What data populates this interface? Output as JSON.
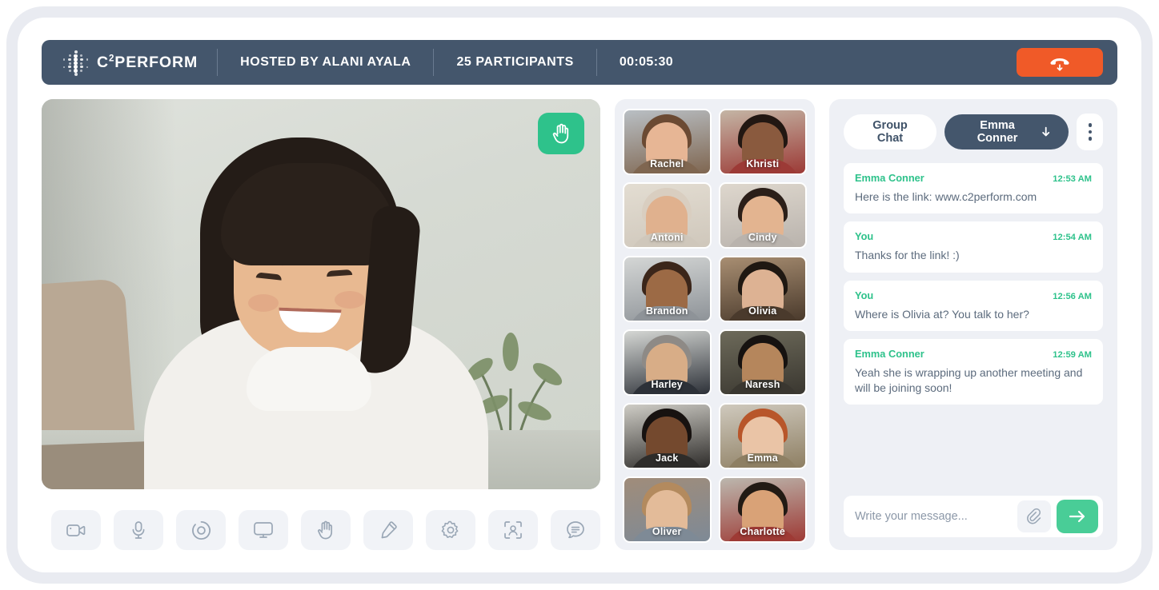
{
  "header": {
    "brand_primary": "C",
    "brand_sup": "2",
    "brand_suffix": "PERFORM",
    "host": "HOSTED BY ALANI AYALA",
    "participants": "25 PARTICIPANTS",
    "timer": "00:05:30",
    "end_call_icon": "hang-up-icon",
    "bg_color": "#44566C",
    "end_call_color": "#F05A28"
  },
  "stage": {
    "raise_hand_icon": "raised-hand-icon",
    "raise_hand_color": "#2EC28B",
    "toolbar": [
      {
        "name": "camera-toggle-button",
        "icon": "video-camera-icon"
      },
      {
        "name": "microphone-toggle-button",
        "icon": "microphone-icon"
      },
      {
        "name": "record-button",
        "icon": "record-circle-icon"
      },
      {
        "name": "share-screen-button",
        "icon": "monitor-icon"
      },
      {
        "name": "raise-hand-button",
        "icon": "raised-hand-icon"
      },
      {
        "name": "annotate-button",
        "icon": "highlighter-pen-icon"
      },
      {
        "name": "settings-button",
        "icon": "gear-icon"
      },
      {
        "name": "participant-view-button",
        "icon": "person-frame-icon"
      },
      {
        "name": "chat-toggle-button",
        "icon": "chat-bubble-icon"
      }
    ]
  },
  "participants": [
    {
      "name": "Rachel",
      "skin": "#e7b695",
      "hair": "#6b4a33",
      "bg": "#b9bfc4",
      "top": "#7f6650"
    },
    {
      "name": "Khristi",
      "skin": "#8a5a3e",
      "hair": "#221712",
      "bg": "#c4b5a5",
      "top": "#9c3a36"
    },
    {
      "name": "Antoni",
      "skin": "#e0b18e",
      "hair": "#d9cec0",
      "bg": "#e3ddd2",
      "top": "#cfc7bb"
    },
    {
      "name": "Cindy",
      "skin": "#e3b490",
      "hair": "#2b1f19",
      "bg": "#ded7cd",
      "top": "#b9b3ad"
    },
    {
      "name": "Brandon",
      "skin": "#9c6a45",
      "hair": "#3b261a",
      "bg": "#d4d6d5",
      "top": "#8e9398"
    },
    {
      "name": "Olivia",
      "skin": "#ddb293",
      "hair": "#1f1812",
      "bg": "#a88e72",
      "top": "#4a3a2c"
    },
    {
      "name": "Harley",
      "skin": "#d8ad87",
      "hair": "#8e8a86",
      "bg": "#d5d7d4",
      "top": "#2d3138"
    },
    {
      "name": "Naresh",
      "skin": "#b5865c",
      "hair": "#161210",
      "bg": "#6d6a5a",
      "top": "#3a3730"
    },
    {
      "name": "Jack",
      "skin": "#74492e",
      "hair": "#171210",
      "bg": "#cfcdc6",
      "top": "#2e2c2a"
    },
    {
      "name": "Emma",
      "skin": "#eac4a6",
      "hair": "#b8562a",
      "bg": "#cfc9bd",
      "top": "#8e7f63"
    },
    {
      "name": "Oliver",
      "skin": "#e3bb99",
      "hair": "#b38a5e",
      "bg": "#a08c7a",
      "top": "#7e8a96"
    },
    {
      "name": "Charlotte",
      "skin": "#d9a277",
      "hair": "#221a14",
      "bg": "#bcb7ae",
      "top": "#9e3a35"
    }
  ],
  "chat": {
    "tab_group": "Group Chat",
    "tab_direct": "Emma Conner",
    "tab_direct_icon": "arrow-down-icon",
    "kebab_icon": "more-vertical-icon",
    "accent_color": "#2EC28B",
    "messages": [
      {
        "author": "Emma Conner",
        "time": "12:53 AM",
        "text": "Here is the link: www.c2perform.com"
      },
      {
        "author": "You",
        "time": "12:54 AM",
        "text": "Thanks for the link! :)"
      },
      {
        "author": "You",
        "time": "12:56 AM",
        "text": "Where is Olivia at? You talk to her?"
      },
      {
        "author": "Emma Conner",
        "time": "12:59 AM",
        "text": "Yeah she is wrapping up another meeting and will be joining soon!"
      }
    ],
    "composer_placeholder": "Write your message...",
    "attach_icon": "paperclip-icon",
    "send_icon": "arrow-right-icon"
  }
}
